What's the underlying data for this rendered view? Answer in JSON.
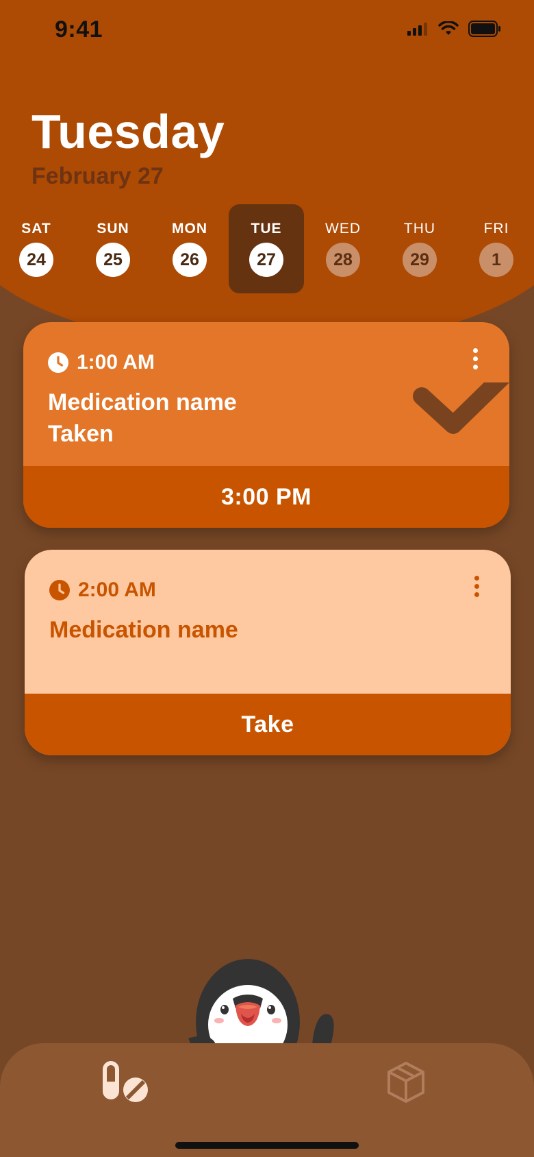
{
  "status_bar": {
    "time": "9:41"
  },
  "header": {
    "title": "Tuesday",
    "date": "February 27"
  },
  "days": [
    {
      "label": "SAT",
      "number": "24"
    },
    {
      "label": "SUN",
      "number": "25"
    },
    {
      "label": "MON",
      "number": "26"
    },
    {
      "label": "TUE",
      "number": "27"
    },
    {
      "label": "WED",
      "number": "28"
    },
    {
      "label": "THU",
      "number": "29"
    },
    {
      "label": "FRI",
      "number": "1"
    }
  ],
  "cards": [
    {
      "time": "1:00 AM",
      "name": "Medication name",
      "status": "Taken",
      "footer": "3:00 PM",
      "color": "#E37628"
    },
    {
      "time": "2:00 AM",
      "name": "Medication name",
      "footer": "Take",
      "color": "#FEC9A0"
    }
  ],
  "colors": {
    "header": "#AD4A04",
    "background": "#764726",
    "accent": "#C85400",
    "tabbar": "#8C5731"
  },
  "tabbar": {
    "items": [
      {
        "icon": "pill-icon"
      },
      {
        "icon": "box-icon"
      }
    ]
  }
}
